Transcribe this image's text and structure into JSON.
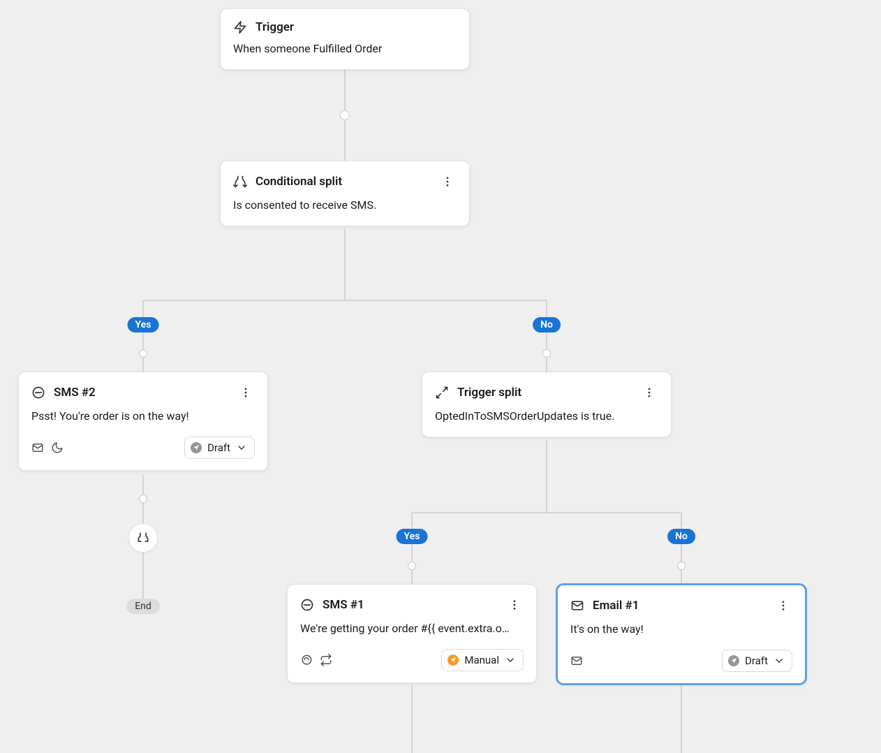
{
  "nodes": {
    "trigger": {
      "title": "Trigger",
      "description": "When someone Fulfilled Order"
    },
    "conditional": {
      "title": "Conditional split",
      "description": "Is consented to receive SMS."
    },
    "sms2": {
      "title": "SMS #2",
      "description": "Psst! You're order is on the way!",
      "status": "Draft"
    },
    "trigger_split": {
      "title": "Trigger split",
      "description": "OptedInToSMSOrderUpdates is true."
    },
    "sms1": {
      "title": "SMS #1",
      "description": "We're getting your order #{{ event.extra.o…",
      "status": "Manual"
    },
    "email1": {
      "title": "Email #1",
      "description": "It's on the way!",
      "status": "Draft"
    }
  },
  "branch_labels": {
    "yes": "Yes",
    "no": "No"
  },
  "end_label": "End"
}
